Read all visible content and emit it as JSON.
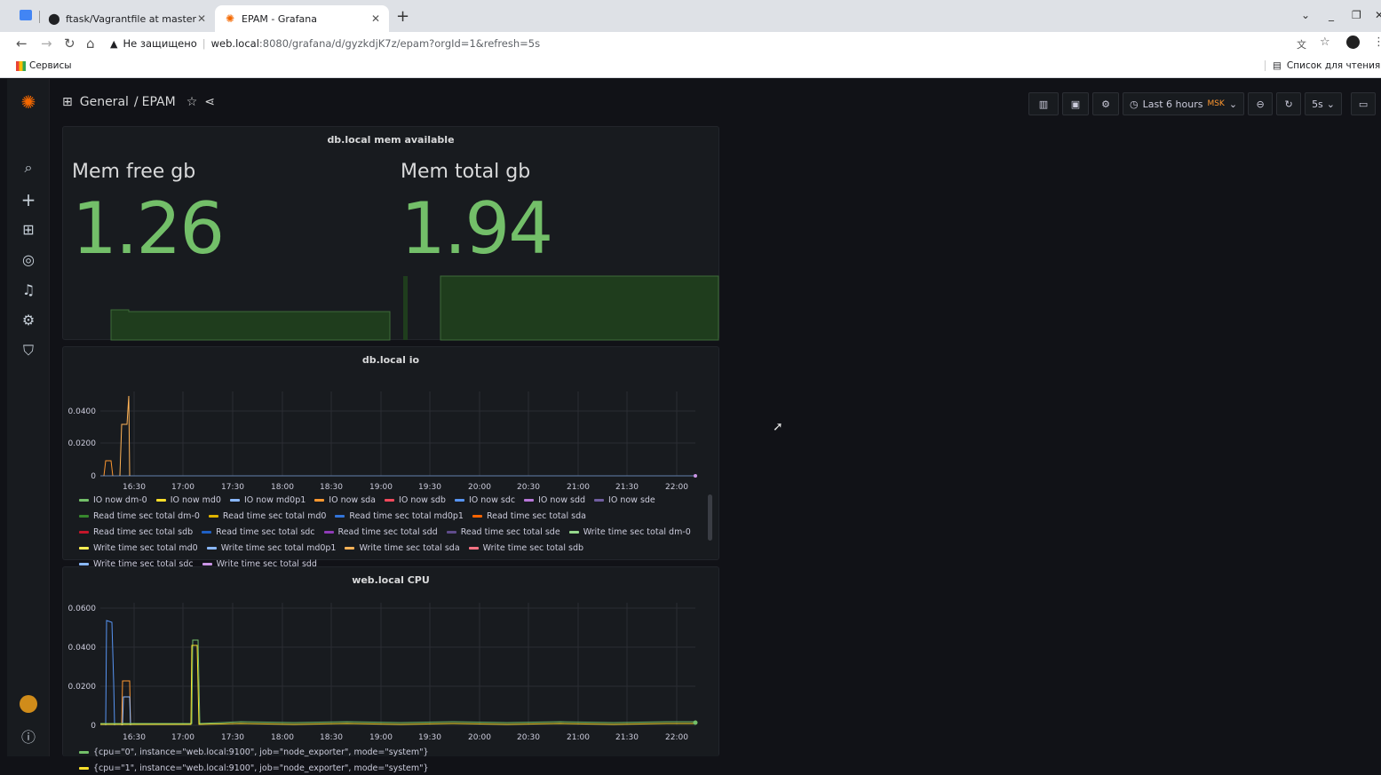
{
  "browser": {
    "tabs": [
      {
        "label": "ftask/Vagrantfile at master",
        "active": false
      },
      {
        "label": "EPAM - Grafana",
        "active": true
      }
    ],
    "new_tab": "+",
    "address": {
      "warning": "Не защищено",
      "host": "web.local",
      "path": ":8080/grafana/d/gyzkdjK7z/epam?orgId=1&refresh=5s"
    },
    "bookmarks": {
      "apps": "Сервисы",
      "reading_list": "Список для чтения"
    }
  },
  "grafana": {
    "breadcrumb": {
      "folder": "General",
      "separator": "/",
      "dashboard": "EPAM"
    },
    "toolbar": {
      "time_range": "Last 6 hours",
      "timezone": "MSK",
      "refresh": "5s"
    },
    "panels": {
      "mem": {
        "title": "db.local mem available",
        "stats": [
          {
            "label": "Mem free gb",
            "value": "1.26"
          },
          {
            "label": "Mem total gb",
            "value": "1.94"
          }
        ]
      },
      "io": {
        "title": "db.local io",
        "yticks": [
          "0.0400",
          "0.0200",
          "0"
        ],
        "xticks": [
          "16:30",
          "17:00",
          "17:30",
          "18:00",
          "18:30",
          "19:00",
          "19:30",
          "20:00",
          "20:30",
          "21:00",
          "21:30",
          "22:00"
        ],
        "legend": [
          {
            "name": "IO now dm-0",
            "color": "#73bf69"
          },
          {
            "name": "IO now md0",
            "color": "#fade2a"
          },
          {
            "name": "IO now md0p1",
            "color": "#8ab8ff"
          },
          {
            "name": "IO now sda",
            "color": "#ff9830"
          },
          {
            "name": "IO now sdb",
            "color": "#f2495c"
          },
          {
            "name": "IO now sdc",
            "color": "#5794f2"
          },
          {
            "name": "IO now sdd",
            "color": "#b877d9"
          },
          {
            "name": "IO now sde",
            "color": "#705da0"
          },
          {
            "name": "Read time sec total dm-0",
            "color": "#37872d"
          },
          {
            "name": "Read time sec total md0",
            "color": "#e0b400"
          },
          {
            "name": "Read time sec total md0p1",
            "color": "#3274d9"
          },
          {
            "name": "Read time sec total sda",
            "color": "#fa6400"
          },
          {
            "name": "Read time sec total sdb",
            "color": "#c4162a"
          },
          {
            "name": "Read time sec total sdc",
            "color": "#1f60c4"
          },
          {
            "name": "Read time sec total sdd",
            "color": "#8f3bb8"
          },
          {
            "name": "Read time sec total sde",
            "color": "#5f4b8b"
          },
          {
            "name": "Write time sec total dm-0",
            "color": "#96d98d"
          },
          {
            "name": "Write time sec total md0",
            "color": "#ffee52"
          },
          {
            "name": "Write time sec total md0p1",
            "color": "#8ab8ff"
          },
          {
            "name": "Write time sec total sda",
            "color": "#ffb357"
          },
          {
            "name": "Write time sec total sdb",
            "color": "#ff7383"
          },
          {
            "name": "Write time sec total sdc",
            "color": "#8ab8ff"
          },
          {
            "name": "Write time sec total sdd",
            "color": "#ca95e5"
          }
        ]
      },
      "cpu": {
        "title": "web.local CPU",
        "yticks": [
          "0.0600",
          "0.0400",
          "0.0200",
          "0"
        ],
        "xticks": [
          "16:30",
          "17:00",
          "17:30",
          "18:00",
          "18:30",
          "19:00",
          "19:30",
          "20:00",
          "20:30",
          "21:00",
          "21:30",
          "22:00"
        ],
        "legend": [
          {
            "name": "{cpu=\"0\", instance=\"web.local:9100\", job=\"node_exporter\", mode=\"system\"}",
            "color": "#73bf69"
          },
          {
            "name": "{cpu=\"1\", instance=\"web.local:9100\", job=\"node_exporter\", mode=\"system\"}",
            "color": "#fade2a"
          }
        ]
      }
    }
  }
}
